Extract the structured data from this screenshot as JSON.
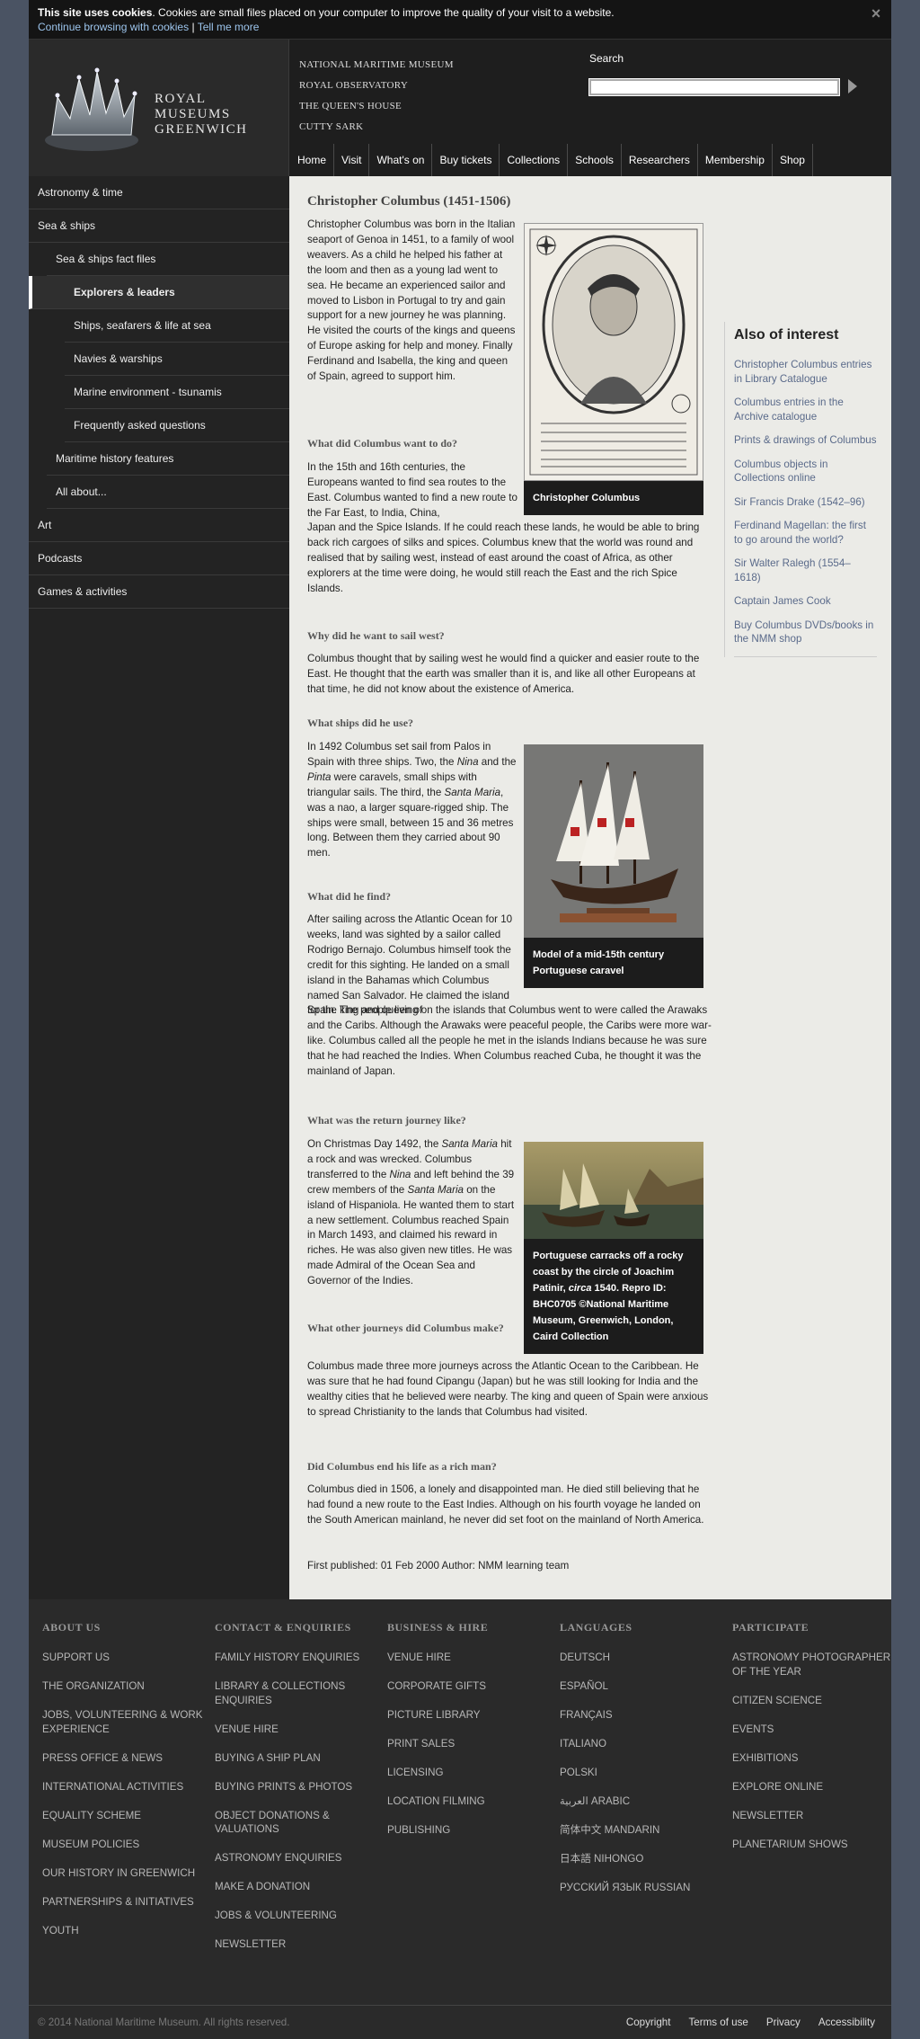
{
  "cookie": {
    "title": "This site uses cookies",
    "text": ". Cookies are small files placed on your computer to improve the quality of your visit to a website.",
    "continue": "Continue browsing with cookies",
    "separator": "|",
    "tell_me_more": "Tell me more",
    "close": "×"
  },
  "header": {
    "logo_lines": [
      "ROYAL",
      "MUSEUMS",
      "GREENWICH"
    ],
    "sites": [
      "NATIONAL MARITIME MUSEUM",
      "ROYAL OBSERVATORY",
      "THE QUEEN'S HOUSE",
      "CUTTY SARK"
    ],
    "search_label": "Search",
    "search_value": "",
    "nav": [
      "Home",
      "Visit",
      "What's on",
      "Buy tickets",
      "Collections",
      "Schools",
      "Researchers",
      "Membership",
      "Shop"
    ]
  },
  "sidebar": [
    {
      "label": "Astronomy & time",
      "level": 1
    },
    {
      "label": "Sea & ships",
      "level": 1
    },
    {
      "label": "Sea & ships fact files",
      "level": 2
    },
    {
      "label": "Explorers & leaders",
      "level": 3,
      "active": true
    },
    {
      "label": "Ships, seafarers & life at sea",
      "level": 3
    },
    {
      "label": "Navies & warships",
      "level": 3
    },
    {
      "label": "Marine environment - tsunamis",
      "level": 3
    },
    {
      "label": "Frequently asked questions",
      "level": 3
    },
    {
      "label": "Maritime history features",
      "level": 2
    },
    {
      "label": "All about...",
      "level": 2
    },
    {
      "label": "Art",
      "level": 1
    },
    {
      "label": "Podcasts",
      "level": 1
    },
    {
      "label": "Games & activities",
      "level": 1
    }
  ],
  "article": {
    "title": "Christopher Columbus (1451-1506)",
    "intro": "Christopher Columbus was born in the Italian seaport of Genoa in 1451, to a family of wool weavers. As a child he helped his father at the loom and then as a young lad went to sea. He became an experienced sailor and moved to Lisbon in Portugal to try and gain support for a new journey he was planning. He visited the courts of the kings and queens of Europe asking for help and money. Finally Ferdinand and Isabella, the king and queen of Spain, agreed to support him.",
    "h_want": "What did Columbus want to do?",
    "p_want_a": "In the 15th and 16th centuries, the Europeans wanted to find sea routes to the East. Columbus wanted to find a new route to the Far East, to India, China,",
    "p_want_b": "Japan and the Spice Islands. If he could reach these lands, he would be able to bring back rich cargoes of silks and spices. Columbus knew that the world was round and realised that by sailing west, instead of east around the coast of Africa, as other explorers at the time were doing, he would still reach the East and the rich Spice Islands.",
    "h_why": "Why did he want to sail west?",
    "p_why": "Columbus thought that by sailing west he would find a quicker and easier route to the East. He thought that the earth was smaller than it is, and like all other Europeans at that time, he did not know about the existence of America.",
    "h_ships": "What ships did he use?",
    "p_ships_1": "In 1492 Columbus set sail from Palos in Spain with three ships. Two, the ",
    "p_ships_nina": "Nina",
    "p_ships_2": " and the ",
    "p_ships_pinta": "Pinta",
    "p_ships_3": " were caravels, small ships with triangular sails. The third, the ",
    "p_ships_santa": "Santa Maria",
    "p_ships_4": ", was a nao, a larger square-rigged ship. The ships were small, between 15 and 36 metres long. Between them they carried about 90 men.",
    "h_find": "What did he find?",
    "p_find_a": "After sailing across the Atlantic Ocean for 10 weeks, land was sighted by a sailor called Rodrigo Bernajo. Columbus himself took the credit for this sighting. He landed on a small island in the Bahamas which Columbus named San Salvador. He claimed the island for the king and queen of",
    "p_find_b": "Spain. The people living on the islands that Columbus went to were called the Arawaks and the Caribs. Although the Arawaks were peaceful people, the Caribs were more war-like. Columbus called all the people he met in the islands Indians because he was sure that he had reached the Indies. When Columbus reached Cuba, he thought it was the mainland of Japan.",
    "h_return": "What was the return journey like?",
    "p_return_1": "On Christmas Day 1492, the ",
    "p_return_santa": "Santa Maria",
    "p_return_2": " hit a rock and was wrecked. Columbus transferred to the ",
    "p_return_nina": "Nina",
    "p_return_3": " and left behind the 39 crew members of the ",
    "p_return_santa2": "Santa Maria",
    "p_return_4": " on the island of Hispaniola. He wanted them to start a new settlement. Columbus reached Spain in March 1493, and claimed his reward in riches. He was also given new titles. He was made Admiral of the Ocean Sea and Governor of the Indies.",
    "h_other": "What other journeys did Columbus make?",
    "p_other": "Columbus made three more journeys across the Atlantic Ocean to the Caribbean. He was sure that he had found Cipangu (Japan) but he was still looking for India and the wealthy cities that he believed were nearby. The king and queen of Spain were anxious to spread Christianity to the lands that Columbus had visited.",
    "h_rich": "Did Columbus end his life as a rich man?",
    "p_rich": "Columbus died in 1506, a lonely and disappointed man. He died still believing that he had found a new route to the East Indies. Although on his fourth voyage he landed on the South American mainland, he never did set foot on the mainland of North America.",
    "published": "First published: 01 Feb 2000 Author: NMM learning team",
    "fig1_caption": "Christopher Columbus",
    "fig2_caption": "Model of a mid-15th century Portuguese caravel",
    "fig3_caption_1": "Portuguese carracks off a rocky coast by the circle of Joachim Patinir, ",
    "fig3_caption_circa": "circa",
    "fig3_caption_2": " 1540. Repro ID: BHC0705 ©National Maritime Museum, Greenwich, London, Caird Collection"
  },
  "aside": {
    "title": "Also of interest",
    "links": [
      "Christopher Columbus entries in Library Catalogue",
      "Columbus entries in the Archive catalogue",
      "Prints & drawings of Columbus",
      "Columbus objects in Collections online",
      "Sir Francis Drake (1542–96)",
      "Ferdinand Magellan: the first to go around the world?",
      "Sir Walter Ralegh (1554–1618)",
      "Captain James Cook",
      "Buy Columbus DVDs/books in the NMM shop"
    ]
  },
  "footer": {
    "columns": [
      {
        "title": "ABOUT US",
        "links": [
          "SUPPORT US",
          "THE ORGANIZATION",
          "JOBS, VOLUNTEERING & WORK EXPERIENCE",
          "PRESS OFFICE & NEWS",
          "INTERNATIONAL ACTIVITIES",
          "EQUALITY SCHEME",
          "MUSEUM POLICIES",
          "OUR HISTORY IN GREENWICH",
          "PARTNERSHIPS & INITIATIVES",
          "YOUTH"
        ]
      },
      {
        "title": "CONTACT & ENQUIRIES",
        "links": [
          "FAMILY HISTORY ENQUIRIES",
          "LIBRARY & COLLECTIONS ENQUIRIES",
          "VENUE HIRE",
          "BUYING A SHIP PLAN",
          "BUYING PRINTS & PHOTOS",
          "OBJECT DONATIONS & VALUATIONS",
          "ASTRONOMY ENQUIRIES",
          "MAKE A DONATION",
          "JOBS & VOLUNTEERING",
          "NEWSLETTER"
        ]
      },
      {
        "title": "BUSINESS & HIRE",
        "links": [
          "VENUE HIRE",
          "CORPORATE GIFTS",
          "PICTURE LIBRARY",
          "PRINT SALES",
          "LICENSING",
          "LOCATION FILMING",
          "PUBLISHING"
        ]
      },
      {
        "title": "LANGUAGES",
        "links": [
          "DEUTSCH",
          "ESPAÑOL",
          "FRANÇAIS",
          "ITALIANO",
          "POLSKI",
          "العربية ARABIC",
          "简体中文 MANDARIN",
          "日本語 NIHONGO",
          "РУССКИЙ ЯЗЫК RUSSIAN"
        ]
      },
      {
        "title": "PARTICIPATE",
        "links": [
          "ASTRONOMY PHOTOGRAPHER OF THE YEAR",
          "CITIZEN SCIENCE",
          "EVENTS",
          "EXHIBITIONS",
          "EXPLORE ONLINE",
          "NEWSLETTER",
          "PLANETARIUM SHOWS"
        ]
      }
    ],
    "copyright": "© 2014 National Maritime Museum. All rights reserved.",
    "bottom_links": [
      "Copyright",
      "Terms of use",
      "Privacy",
      "Accessibility"
    ]
  }
}
